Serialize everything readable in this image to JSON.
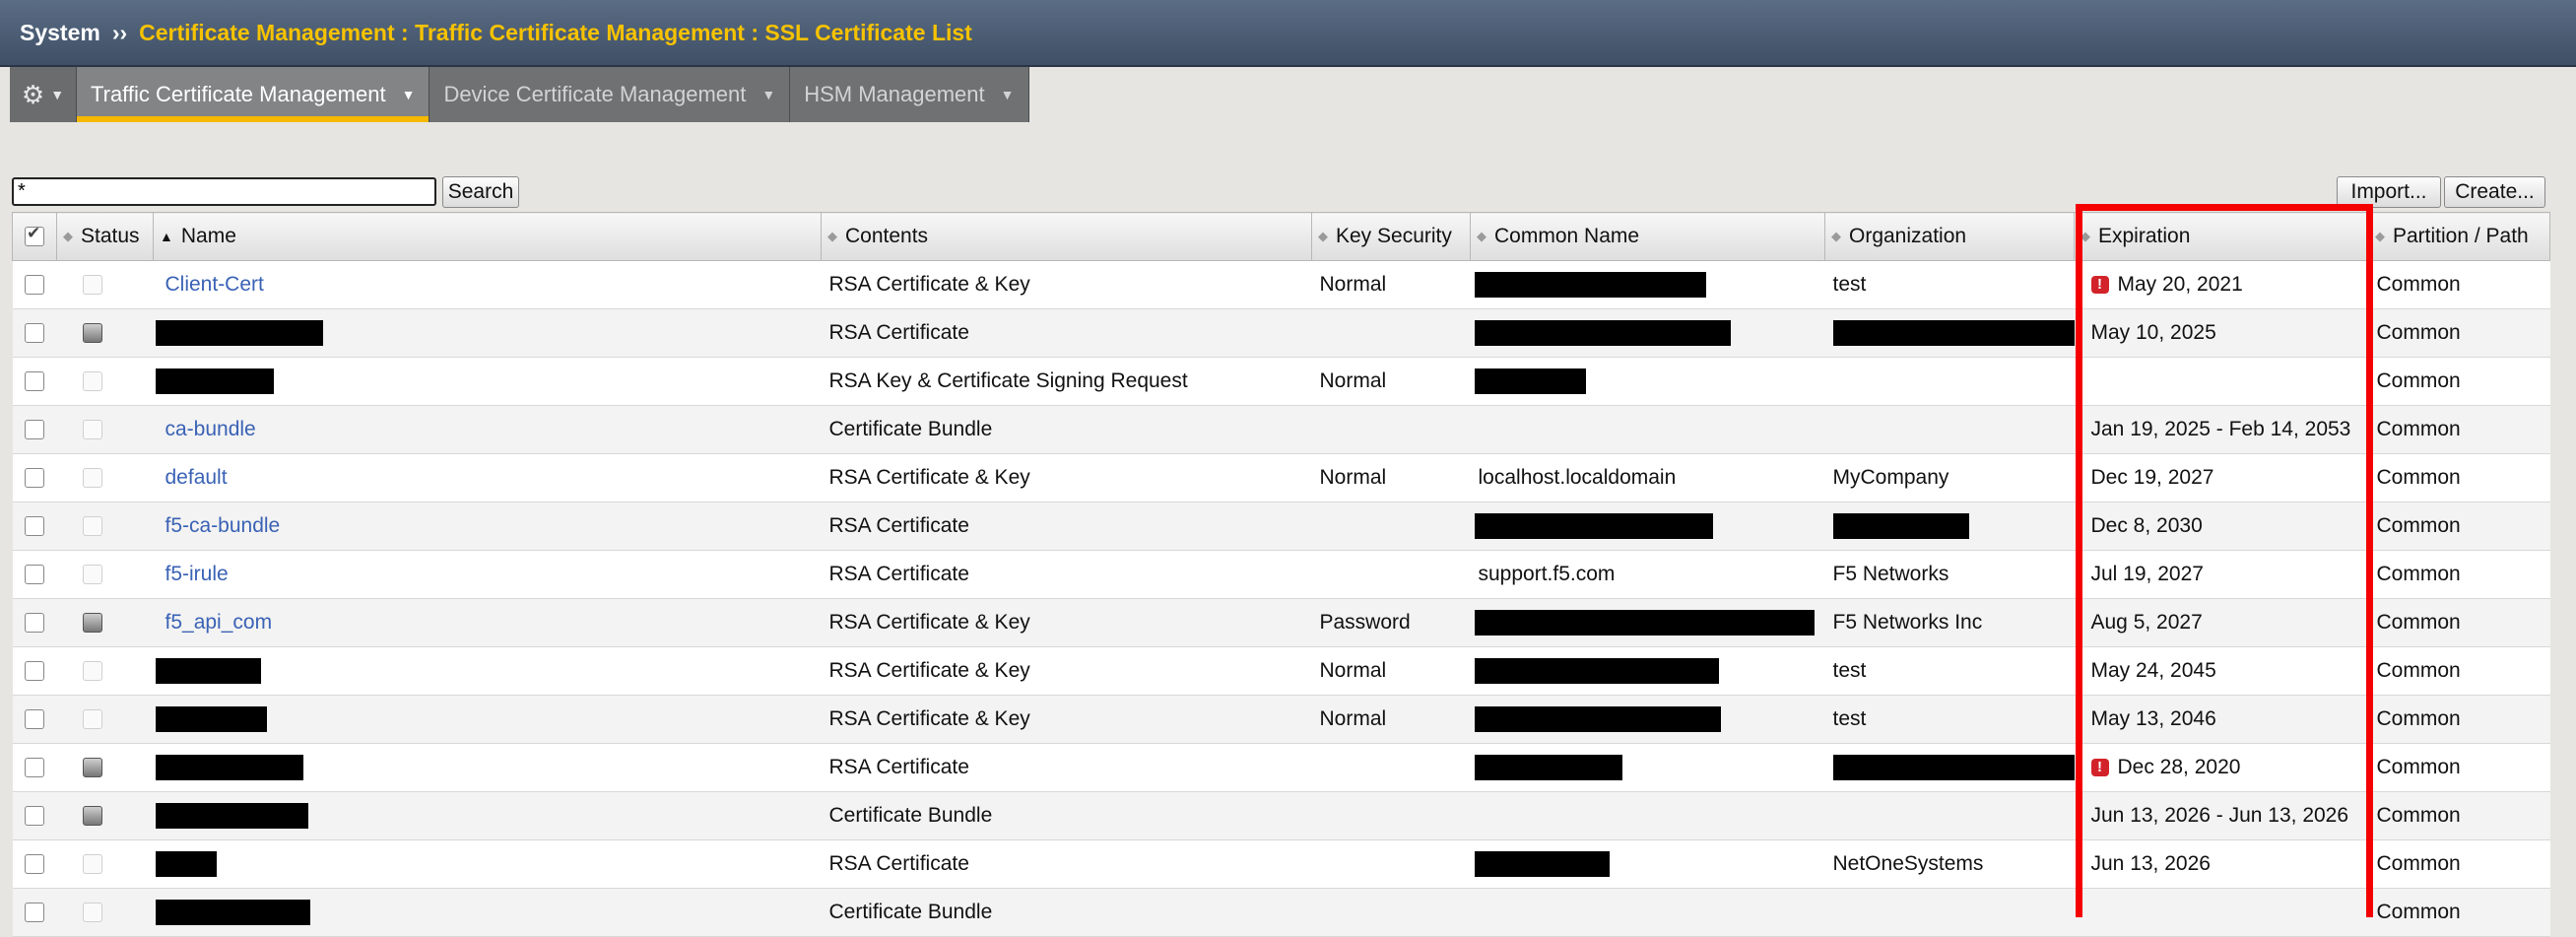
{
  "breadcrumb": {
    "root": "System",
    "separator": "››",
    "path": "Certificate Management : Traffic Certificate Management : SSL Certificate List"
  },
  "menu": {
    "tabs": [
      {
        "label": "Traffic Certificate Management",
        "active": true
      },
      {
        "label": "Device Certificate Management",
        "active": false
      },
      {
        "label": "HSM Management",
        "active": false
      }
    ]
  },
  "search": {
    "value": "*",
    "button_label": "Search"
  },
  "actions": {
    "import_label": "Import...",
    "create_label": "Create..."
  },
  "table": {
    "columns": [
      "Status",
      "Name",
      "Contents",
      "Key Security",
      "Common Name",
      "Organization",
      "Expiration",
      "Partition / Path"
    ],
    "rows": [
      {
        "status": "none",
        "name": "Client-Cert",
        "name_redacted_w": 0,
        "contents": "RSA Certificate & Key",
        "key_security": "Normal",
        "common_name": "",
        "cn_redacted_w": 235,
        "organization": "test",
        "org_redacted_w": 0,
        "expiration": "May 20, 2021",
        "expired": true,
        "partition": "Common"
      },
      {
        "status": "gray",
        "name": "",
        "name_redacted_w": 170,
        "contents": "RSA Certificate",
        "key_security": "",
        "common_name": "",
        "cn_redacted_w": 260,
        "organization": "",
        "org_redacted_w": 250,
        "expiration": "May 10, 2025",
        "expired": false,
        "partition": "Common"
      },
      {
        "status": "none",
        "name": "",
        "name_redacted_w": 120,
        "contents": "RSA Key & Certificate Signing Request",
        "key_security": "Normal",
        "common_name": "",
        "cn_redacted_w": 113,
        "organization": "",
        "org_redacted_w": 0,
        "expiration": "",
        "expired": false,
        "partition": "Common"
      },
      {
        "status": "none",
        "name": "ca-bundle",
        "name_redacted_w": 0,
        "contents": "Certificate Bundle",
        "key_security": "",
        "common_name": "",
        "cn_redacted_w": 0,
        "organization": "",
        "org_redacted_w": 0,
        "expiration": "Jan 19, 2025 - Feb 14, 2053",
        "expired": false,
        "partition": "Common"
      },
      {
        "status": "none",
        "name": "default",
        "name_redacted_w": 0,
        "contents": "RSA Certificate & Key",
        "key_security": "Normal",
        "common_name": "localhost.localdomain",
        "cn_redacted_w": 0,
        "organization": "MyCompany",
        "org_redacted_w": 0,
        "expiration": "Dec 19, 2027",
        "expired": false,
        "partition": "Common"
      },
      {
        "status": "none",
        "name": "f5-ca-bundle",
        "name_redacted_w": 0,
        "contents": "RSA Certificate",
        "key_security": "",
        "common_name": "",
        "cn_redacted_w": 242,
        "organization": "",
        "org_redacted_w": 138,
        "expiration": "Dec 8, 2030",
        "expired": false,
        "partition": "Common"
      },
      {
        "status": "none",
        "name": "f5-irule",
        "name_redacted_w": 0,
        "contents": "RSA Certificate",
        "key_security": "",
        "common_name": "support.f5.com",
        "cn_redacted_w": 0,
        "organization": "F5 Networks",
        "org_redacted_w": 0,
        "expiration": "Jul 19, 2027",
        "expired": false,
        "partition": "Common"
      },
      {
        "status": "gray",
        "name": "f5_api_com",
        "name_redacted_w": 0,
        "contents": "RSA Certificate & Key",
        "key_security": "Password",
        "common_name": "",
        "cn_redacted_w": 345,
        "organization": "F5 Networks Inc",
        "org_redacted_w": 0,
        "expiration": "Aug 5, 2027",
        "expired": false,
        "partition": "Common"
      },
      {
        "status": "none",
        "name": "",
        "name_redacted_w": 107,
        "contents": "RSA Certificate & Key",
        "key_security": "Normal",
        "common_name": "",
        "cn_redacted_w": 248,
        "organization": "test",
        "org_redacted_w": 0,
        "expiration": "May 24, 2045",
        "expired": false,
        "partition": "Common"
      },
      {
        "status": "none",
        "name": "",
        "name_redacted_w": 113,
        "contents": "RSA Certificate & Key",
        "key_security": "Normal",
        "common_name": "",
        "cn_redacted_w": 250,
        "organization": "test",
        "org_redacted_w": 0,
        "expiration": "May 13, 2046",
        "expired": false,
        "partition": "Common"
      },
      {
        "status": "gray",
        "name": "",
        "name_redacted_w": 150,
        "contents": "RSA Certificate",
        "key_security": "",
        "common_name": "",
        "cn_redacted_w": 150,
        "organization": "",
        "org_redacted_w": 245,
        "expiration": "Dec 28, 2020",
        "expired": true,
        "partition": "Common"
      },
      {
        "status": "gray",
        "name": "",
        "name_redacted_w": 155,
        "contents": "Certificate Bundle",
        "key_security": "",
        "common_name": "",
        "cn_redacted_w": 0,
        "organization": "",
        "org_redacted_w": 0,
        "expiration": "Jun 13, 2026 - Jun 13, 2026",
        "expired": false,
        "partition": "Common"
      },
      {
        "status": "none",
        "name": "",
        "name_redacted_w": 62,
        "contents": "RSA Certificate",
        "key_security": "",
        "common_name": "",
        "cn_redacted_w": 137,
        "organization": "NetOneSystems",
        "org_redacted_w": 0,
        "expiration": "Jun 13, 2026",
        "expired": false,
        "partition": "Common"
      },
      {
        "status": "none",
        "name": "",
        "name_redacted_w": 157,
        "contents": "Certificate Bundle",
        "key_security": "",
        "common_name": "",
        "cn_redacted_w": 0,
        "organization": "",
        "org_redacted_w": 0,
        "expiration": "",
        "expired": false,
        "partition": "Common"
      }
    ]
  },
  "colors": {
    "accent": "#f6c200",
    "link": "#3a62b5",
    "highlight": "#f40000",
    "warning": "#d2232a"
  }
}
